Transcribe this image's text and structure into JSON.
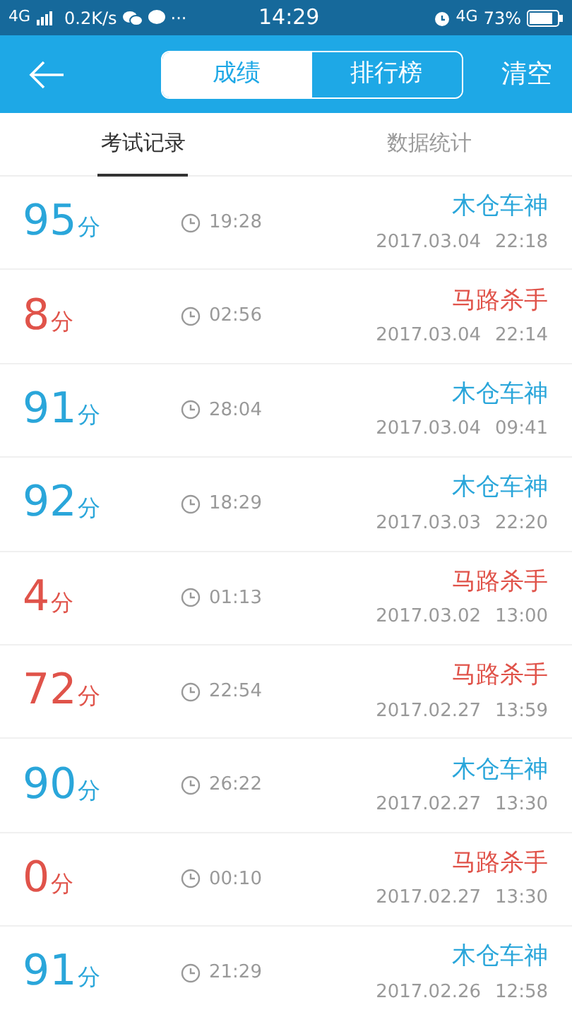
{
  "status_bar": {
    "network": "4G",
    "speed": "0.2K/s",
    "more": "···",
    "time": "14:29",
    "network_right": "4G",
    "battery": "73%"
  },
  "header": {
    "segments": [
      {
        "label": "成绩",
        "selected": true
      },
      {
        "label": "排行榜",
        "selected": false
      }
    ],
    "action": "清空"
  },
  "tabs": [
    {
      "label": "考试记录",
      "selected": true
    },
    {
      "label": "数据统计",
      "selected": false
    }
  ],
  "records": [
    {
      "kind": "pass",
      "score": "95",
      "unit": "分",
      "duration": "19:28",
      "title": "木仓车神",
      "date": "2017.03.04",
      "time": "22:18"
    },
    {
      "kind": "fail",
      "score": "8",
      "unit": "分",
      "duration": "02:56",
      "title": "马路杀手",
      "date": "2017.03.04",
      "time": "22:14"
    },
    {
      "kind": "pass",
      "score": "91",
      "unit": "分",
      "duration": "28:04",
      "title": "木仓车神",
      "date": "2017.03.04",
      "time": "09:41"
    },
    {
      "kind": "pass",
      "score": "92",
      "unit": "分",
      "duration": "18:29",
      "title": "木仓车神",
      "date": "2017.03.03",
      "time": "22:20"
    },
    {
      "kind": "fail",
      "score": "4",
      "unit": "分",
      "duration": "01:13",
      "title": "马路杀手",
      "date": "2017.03.02",
      "time": "13:00"
    },
    {
      "kind": "fail",
      "score": "72",
      "unit": "分",
      "duration": "22:54",
      "title": "马路杀手",
      "date": "2017.02.27",
      "time": "13:59"
    },
    {
      "kind": "pass",
      "score": "90",
      "unit": "分",
      "duration": "26:22",
      "title": "木仓车神",
      "date": "2017.02.27",
      "time": "13:30"
    },
    {
      "kind": "fail",
      "score": "0",
      "unit": "分",
      "duration": "00:10",
      "title": "马路杀手",
      "date": "2017.02.27",
      "time": "13:30"
    },
    {
      "kind": "pass",
      "score": "91",
      "unit": "分",
      "duration": "21:29",
      "title": "木仓车神",
      "date": "2017.02.26",
      "time": "12:58"
    }
  ]
}
